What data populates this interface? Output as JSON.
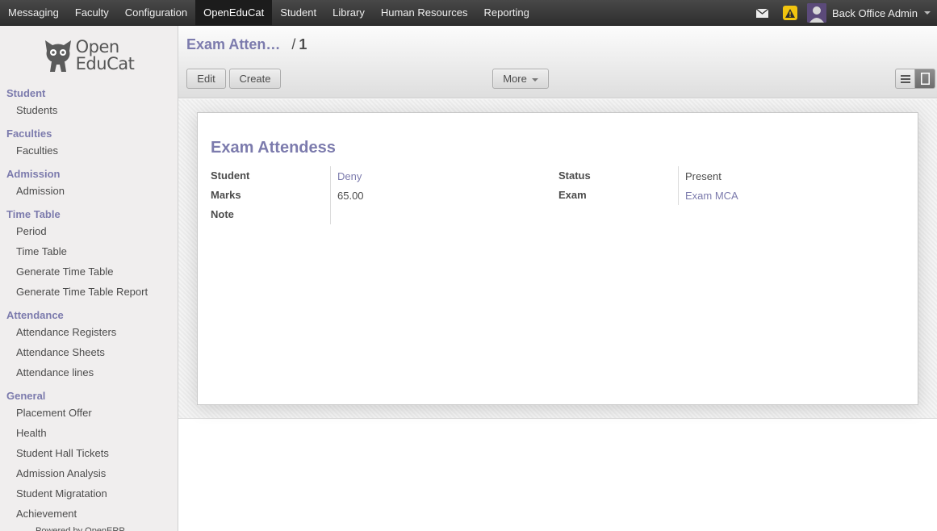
{
  "topbar": {
    "menu": [
      "Messaging",
      "Faculty",
      "Configuration",
      "OpenEduCat",
      "Student",
      "Library",
      "Human Resources",
      "Reporting"
    ],
    "active_index": 3,
    "user_name": "Back Office Admin",
    "icons": [
      "mail-icon",
      "warning-icon",
      "avatar",
      "chevron-down-icon"
    ]
  },
  "logo": {
    "line1": "Open",
    "line2": "EduCat"
  },
  "sidebar": {
    "sections": [
      {
        "title": "Student",
        "items": [
          "Students"
        ]
      },
      {
        "title": "Faculties",
        "items": [
          "Faculties"
        ]
      },
      {
        "title": "Admission",
        "items": [
          "Admission"
        ]
      },
      {
        "title": "Time Table",
        "items": [
          "Period",
          "Time Table",
          "Generate Time Table",
          "Generate Time Table Report"
        ]
      },
      {
        "title": "Attendance",
        "items": [
          "Attendance Registers",
          "Attendance Sheets",
          "Attendance lines"
        ]
      },
      {
        "title": "General",
        "items": [
          "Placement Offer",
          "Health",
          "Student Hall Tickets",
          "Admission Analysis",
          "Student Migratation",
          "Achievement"
        ]
      }
    ],
    "footer_partial": "Powered by OpenERP"
  },
  "breadcrumb": {
    "parent": "Exam Atten…",
    "sep": "/",
    "current": "1"
  },
  "buttons": {
    "edit": "Edit",
    "create": "Create",
    "more": "More"
  },
  "view_switch": [
    "list-view-icon",
    "form-view-icon"
  ],
  "form": {
    "title": "Exam Attendess",
    "fields_left": [
      {
        "label": "Student",
        "value": "Deny",
        "link": true
      },
      {
        "label": "Marks",
        "value": "65.00",
        "link": false
      },
      {
        "label": "Note",
        "value": "",
        "link": false
      }
    ],
    "fields_right": [
      {
        "label": "Status",
        "value": "Present",
        "link": false
      },
      {
        "label": "Exam",
        "value": "Exam MCA",
        "link": true
      }
    ]
  },
  "colors": {
    "accent": "#7c7bad",
    "topbar": "#3a3a3a",
    "sidebar_bg": "#f0eeee",
    "warning": "#f1c40f"
  }
}
